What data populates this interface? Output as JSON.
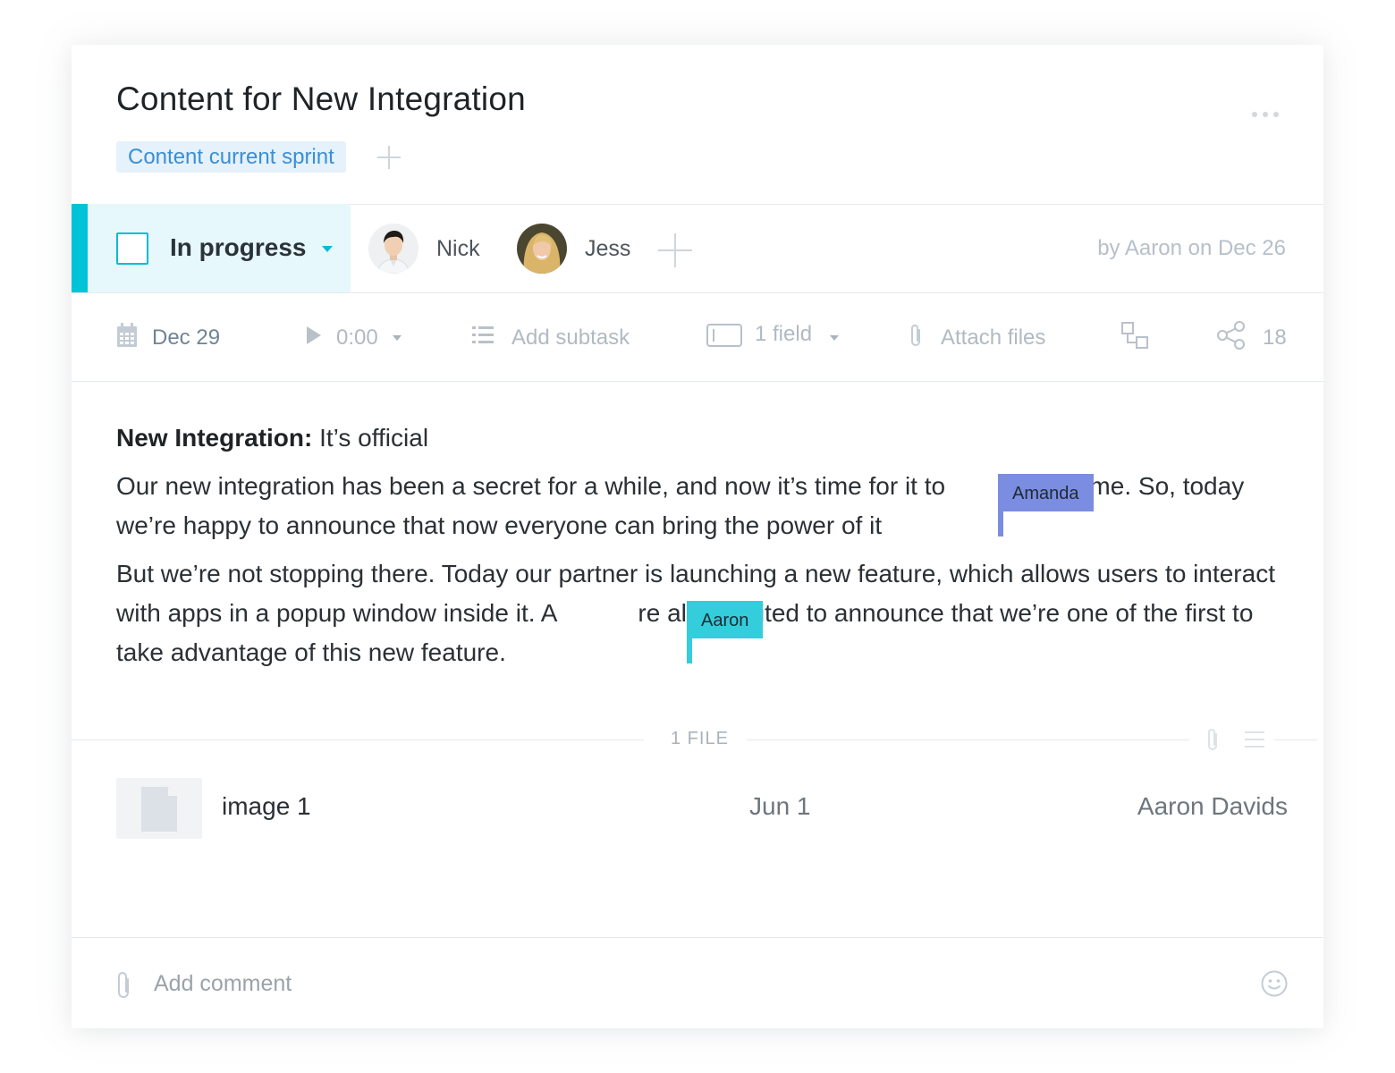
{
  "task": {
    "title": "Content for New Integration",
    "tag": "Content current sprint",
    "status": "In progress",
    "assignees": [
      {
        "name": "Nick"
      },
      {
        "name": "Jess"
      }
    ],
    "byline": "by Aaron on Dec 26"
  },
  "toolbar": {
    "due_date": "Dec 29",
    "timer": "0:00",
    "add_subtask": "Add subtask",
    "fields": "1 field",
    "attach_files": "Attach files",
    "share_count": "18"
  },
  "content": {
    "lead_bold": "New Integration:",
    "lead_rest": " It’s official",
    "p1_a": "Our new integration has been a secret for a while, and now it’s time for it to ",
    "p1_b": "ig time. So, today we’re happy to announce that now everyone can bring the power of it",
    "p2_a": "But we’re not stopping there. Today our partner is launching a new feature, which allows users to interact with apps in a popup window inside  it. A",
    "p2_b": "re also excited to announce that we’re one of the first to take advantage of this new feature."
  },
  "collaborators": [
    {
      "name": "Amanda",
      "color": "#7b8de0"
    },
    {
      "name": "Aaron",
      "color": "#33cddc"
    }
  ],
  "files": {
    "header": "1 FILE",
    "items": [
      {
        "name": "image 1",
        "date": "Jun 1",
        "owner": "Aaron Davids"
      }
    ]
  },
  "comment": {
    "placeholder": "Add comment"
  },
  "colors": {
    "accent": "#00c2d8",
    "tag_text": "#3a8fd6",
    "tag_bg": "#e5f1fb"
  },
  "icons": [
    "more-icon",
    "plus-icon",
    "calendar-icon",
    "play-icon",
    "subtask-icon",
    "field-icon",
    "paperclip-icon",
    "dependency-icon",
    "share-icon",
    "file-icon",
    "list-icon",
    "emoji-icon"
  ]
}
